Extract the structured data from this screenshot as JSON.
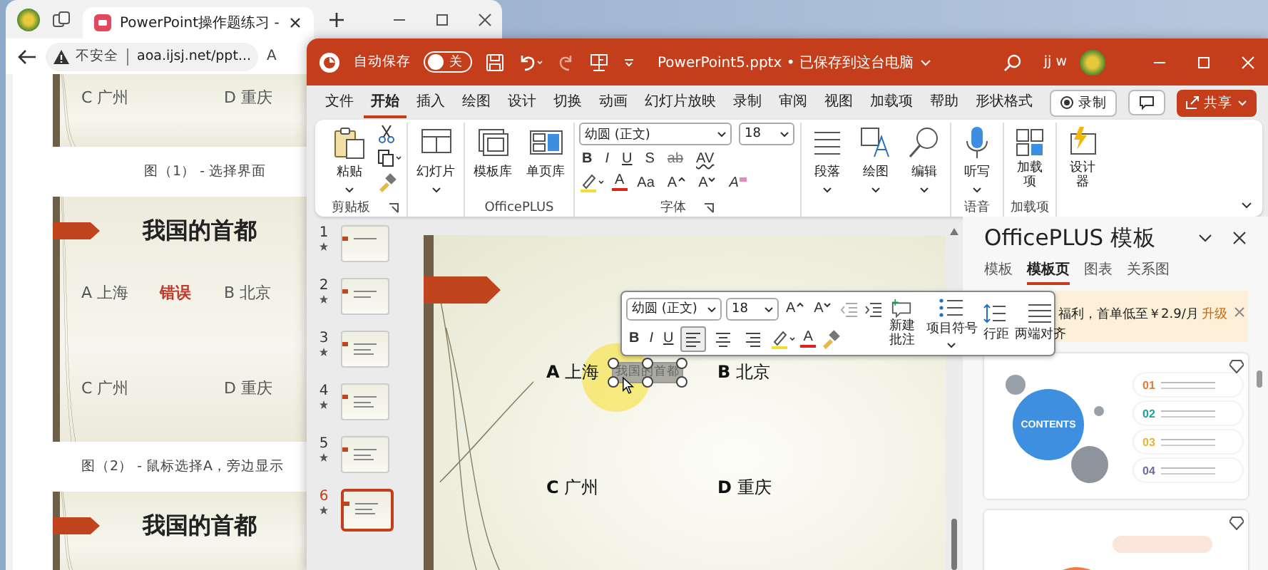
{
  "browser": {
    "tab_title": "PowerPoint操作题练习 -",
    "security": "不安全",
    "url": "aoa.ijsj.net/ppt...",
    "toolbar_text": "A",
    "slides": [
      {
        "options": [
          {
            "text": "C 广州",
            "kind": "option"
          },
          {
            "text": "D 重庆",
            "kind": "option"
          }
        ],
        "caption": "图（1） - 选择界面"
      },
      {
        "title": "我国的首都",
        "options": [
          {
            "text": "A 上海",
            "kind": "option"
          },
          {
            "text": "错误",
            "kind": "wrong"
          },
          {
            "text": "B 北京",
            "kind": "option"
          },
          {
            "text": "C 广州",
            "kind": "option"
          },
          {
            "text": "D 重庆",
            "kind": "option"
          }
        ],
        "caption": "图（2） - 鼠标选择A，旁边显示"
      },
      {
        "title": "我国的首都"
      }
    ]
  },
  "powerpoint": {
    "autosave": {
      "label": "自动保存",
      "state": "关",
      "on": false
    },
    "title": "PowerPoint5.pptx • 已保存到这台电脑",
    "user": "jj w",
    "tabs": [
      {
        "label": "文件",
        "selected": false
      },
      {
        "label": "开始",
        "selected": true
      },
      {
        "label": "插入",
        "selected": false
      },
      {
        "label": "绘图",
        "selected": false
      },
      {
        "label": "设计",
        "selected": false
      },
      {
        "label": "切换",
        "selected": false
      },
      {
        "label": "动画",
        "selected": false
      },
      {
        "label": "幻灯片放映",
        "selected": false
      },
      {
        "label": "录制",
        "selected": false
      },
      {
        "label": "审阅",
        "selected": false
      },
      {
        "label": "视图",
        "selected": false
      },
      {
        "label": "加载项",
        "selected": false
      },
      {
        "label": "帮助",
        "selected": false
      },
      {
        "label": "形状格式",
        "selected": false
      }
    ],
    "record_button": "录制",
    "share_button": "共享",
    "ribbon": {
      "paste": "粘贴",
      "clipboard_group": "剪贴板",
      "new_slide": "幻灯片",
      "templates": "模板库",
      "pages": "单页库",
      "officeplus_group": "OfficePLUS",
      "font_name": "幼圆 (正文)",
      "font_size": "18",
      "format": [
        "B",
        "I",
        "U",
        "S",
        "ab",
        "AV"
      ],
      "color_letter": "A",
      "case": "Aa",
      "grow": "A",
      "shrink": "A",
      "clear": "A",
      "font_group": "字体",
      "paragraph": "段落",
      "drawing": "绘图",
      "editing": "编辑",
      "dictate": "听写",
      "voice_group": "语音",
      "addins": "加载项",
      "addins_group": "加载项",
      "designer": "设计器"
    },
    "thumbnails": [
      {
        "number": "1",
        "selected": false
      },
      {
        "number": "2",
        "selected": false
      },
      {
        "number": "3",
        "selected": false
      },
      {
        "number": "4",
        "selected": false
      },
      {
        "number": "5",
        "selected": false
      },
      {
        "number": "6",
        "selected": true
      }
    ],
    "slide": {
      "options": [
        "**A** 上海",
        "**B** 北京",
        "**C** 广州",
        "**D** 重庆"
      ],
      "selected_text": "我国的首都"
    },
    "mini_toolbar": {
      "font": "幼圆 (正文)",
      "size": "18",
      "grow": "A",
      "shrink": "A",
      "bold": "B",
      "italic": "I",
      "underline": "U",
      "color_letter": "A",
      "align": [
        {
          "selected": true
        },
        {
          "selected": false
        },
        {
          "selected": false
        }
      ],
      "comment": "新建批注",
      "bullets": "项目符号",
      "line_spacing": "行距",
      "justify": "两端对齐"
    },
    "pane": {
      "title": "OfficePLUS 模板",
      "tabs": [
        {
          "label": "模板",
          "selected": false
        },
        {
          "label": "模板页",
          "selected": true
        },
        {
          "label": "图表",
          "selected": false
        },
        {
          "label": "关系图",
          "selected": false
        }
      ],
      "banner": "福利，首单低至￥2.9/月",
      "upgrade": "升级",
      "card": {
        "heading": "CONTENTS",
        "items": [
          {
            "number": "01",
            "color": "#e07b39"
          },
          {
            "number": "02",
            "color": "#1b9e9e"
          },
          {
            "number": "03",
            "color": "#e7b43c"
          },
          {
            "number": "04",
            "color": "#6a6aa6"
          }
        ]
      }
    }
  }
}
